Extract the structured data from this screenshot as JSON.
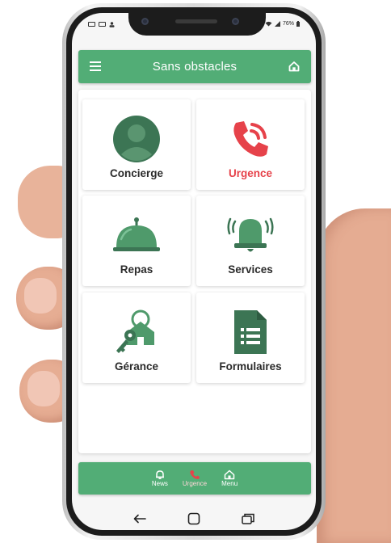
{
  "app": {
    "title": "Sans obstacles"
  },
  "statusbar": {
    "battery": "76%"
  },
  "tiles": [
    {
      "label": "Concierge",
      "icon": "concierge-avatar-icon"
    },
    {
      "label": "Urgence",
      "icon": "emergency-phone-icon",
      "color": "#e6424a"
    },
    {
      "label": "Repas",
      "icon": "meal-cloche-icon"
    },
    {
      "label": "Services",
      "icon": "service-bell-icon"
    },
    {
      "label": "Gérance",
      "icon": "house-key-icon"
    },
    {
      "label": "Formulaires",
      "icon": "form-document-icon"
    }
  ],
  "bottomnav": {
    "items": [
      {
        "label": "News",
        "icon": "bell-icon"
      },
      {
        "label": "Urgence",
        "icon": "phone-icon"
      },
      {
        "label": "Menu",
        "icon": "home-icon"
      }
    ]
  },
  "colors": {
    "accent": "#52ad76",
    "icon_green": "#3c7554",
    "danger": "#e6424a"
  }
}
